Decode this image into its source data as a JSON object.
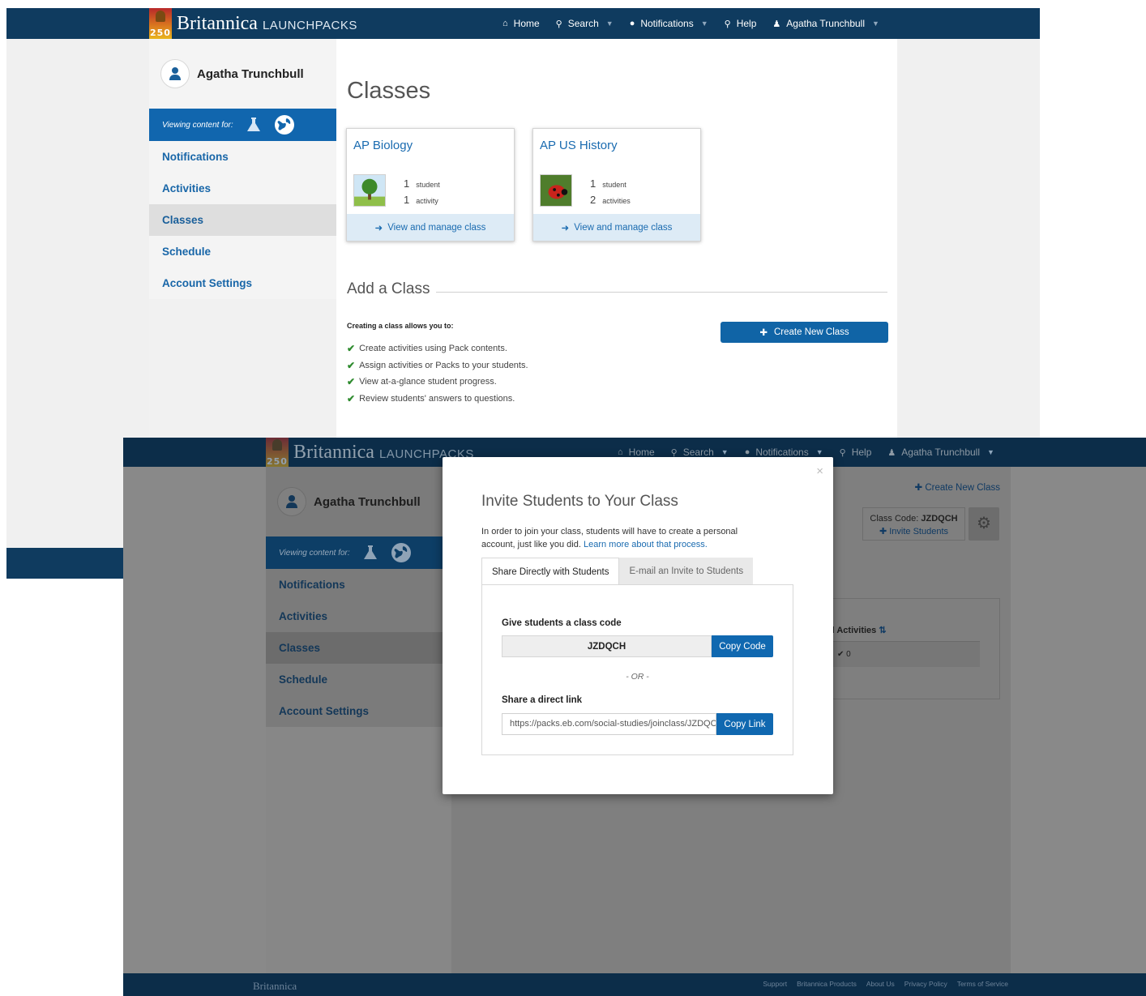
{
  "app": {
    "brand": "Britannica",
    "brand_sub": "LAUNCHPACKS",
    "badge_number": "250"
  },
  "nav": {
    "home": "Home",
    "search": "Search",
    "notifications": "Notifications",
    "help": "Help",
    "user": "Agatha Trunchbull"
  },
  "sidebar": {
    "user_name": "Agatha Trunchbull",
    "viewing_label": "Viewing content for:",
    "items": [
      {
        "label": "Notifications"
      },
      {
        "label": "Activities"
      },
      {
        "label": "Classes"
      },
      {
        "label": "Schedule"
      },
      {
        "label": "Account Settings"
      }
    ]
  },
  "classes_page": {
    "title": "Classes",
    "cards": [
      {
        "name": "AP Biology",
        "students_count": "1",
        "students_label": "student",
        "activities_count": "1",
        "activities_label": "activity",
        "manage_label": "View and manage class",
        "thumb": "tree-thumbnail"
      },
      {
        "name": "AP US History",
        "students_count": "1",
        "students_label": "student",
        "activities_count": "2",
        "activities_label": "activities",
        "manage_label": "View and manage class",
        "thumb": "ladybug-thumbnail"
      }
    ],
    "add_class_heading": "Add a Class",
    "allows_heading": "Creating a class allows you to:",
    "benefits": [
      "Create activities using Pack contents.",
      "Assign activities or Packs to your students.",
      "View at-a-glance student progress.",
      "Review students' answers to questions."
    ],
    "create_button": "Create New Class"
  },
  "class_detail_bg": {
    "create_link": "Create New Class",
    "class_code_prefix": "Class Code:",
    "class_code": "JZDQCH",
    "invite_students": "Invite Students",
    "activities_header": "d Activities",
    "activities_value": "0"
  },
  "modal": {
    "close": "×",
    "title": "Invite Students to Your Class",
    "description": "In order to join your class, students will have to create a personal account, just like you did.",
    "learn_more": "Learn more about that process.",
    "tab_share": "Share Directly with Students",
    "tab_email": "E-mail an Invite to Students",
    "code_label": "Give students a class code",
    "code_value": "JZDQCH",
    "copy_code": "Copy Code",
    "or_text": "- OR -",
    "link_label": "Share a direct link",
    "link_value": "https://packs.eb.com/social-studies/joinclass/JZDQCH",
    "copy_link": "Copy Link"
  },
  "footer": {
    "brand": "Britannica",
    "links": [
      "Support",
      "Britannica Products",
      "About Us",
      "Privacy Policy",
      "Terms of Service"
    ]
  },
  "colors": {
    "topbar": "#0f3b5f",
    "accent_blue": "#1166ae",
    "link_blue": "#1a6bb0",
    "check_green": "#2e8b2e"
  }
}
